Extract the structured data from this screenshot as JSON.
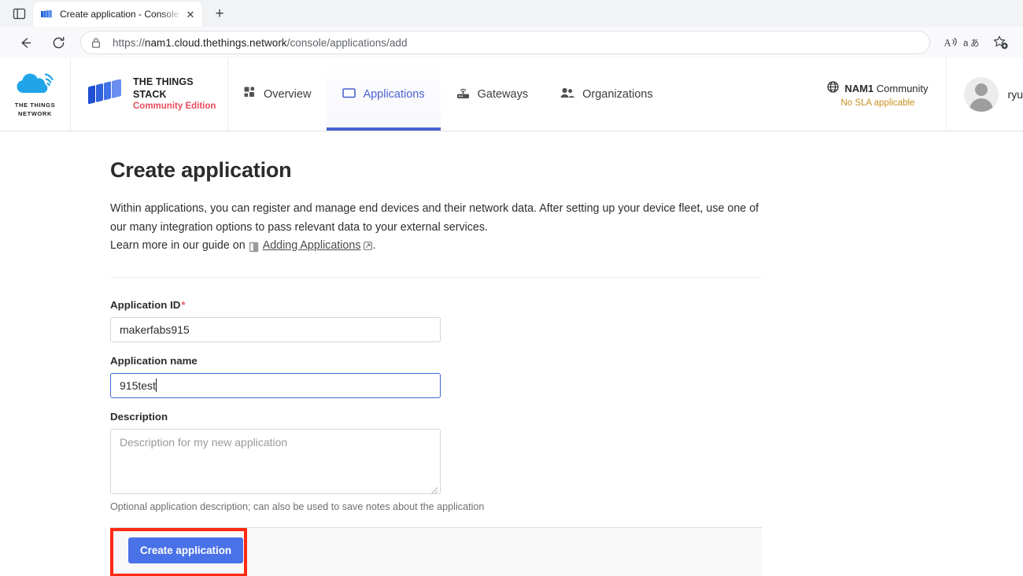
{
  "browser": {
    "tab": {
      "title": "Create application - Console - Th",
      "favicon_name": "ttn-stack-favicon",
      "close_label": "✕"
    },
    "new_tab_label": "+",
    "tab_tools_icon": "tab-list-icon",
    "nav": {
      "back_icon": "back-arrow-icon",
      "reload_icon": "reload-icon"
    },
    "omnibox": {
      "lock_icon": "lock-icon",
      "url_scheme": "https://",
      "url_host": "nam1.cloud.thethings.network",
      "url_path": "/console/applications/add",
      "read_aloud_icon": "read-aloud-icon",
      "translate_icon": "translate-icon",
      "favorite_icon": "add-favorite-star-icon"
    }
  },
  "app_header": {
    "logo": {
      "name": "the-things-network-logo",
      "line1": "THE THINGS",
      "line2": "NETWORK"
    },
    "brand": {
      "icon_name": "things-stack-blocks-icon",
      "line1": "THE THINGS STACK",
      "line2": "Community Edition",
      "accent_color": "#ea4b5a"
    },
    "nav_tabs": [
      {
        "label": "Overview",
        "icon": "grid-overview-icon",
        "active": false
      },
      {
        "label": "Applications",
        "icon": "application-square-icon",
        "active": true
      },
      {
        "label": "Gateways",
        "icon": "gateway-router-icon",
        "active": false
      },
      {
        "label": "Organizations",
        "icon": "organizations-people-icon",
        "active": false
      }
    ],
    "cluster": {
      "globe_icon": "globe-icon",
      "name": "NAM1",
      "type": "Community",
      "sla": "No SLA applicable",
      "sla_color": "#c8901f"
    },
    "user": {
      "avatar_name": "user-avatar-placeholder",
      "username": "ryu"
    },
    "active_tab_color": "#4b61d1"
  },
  "page": {
    "title": "Create application",
    "intro_paragraph": "Within applications, you can register and manage end devices and their network data. After setting up your device fleet, use one of our many integration options to pass relevant data to your external services.",
    "guide_prefix": "Learn more in our guide on",
    "guide_link": "Adding Applications",
    "guide_suffix": ".",
    "guide_doc_icon": "document-book-icon",
    "guide_external_icon": "external-link-icon"
  },
  "form": {
    "application_id": {
      "label": "Application ID",
      "required_mark": "*",
      "value": "makerfabs915",
      "placeholder": ""
    },
    "application_name": {
      "label": "Application name",
      "value": "915test",
      "placeholder": "",
      "focused": true
    },
    "description": {
      "label": "Description",
      "value": "",
      "placeholder": "Description for my new application",
      "help": "Optional application description; can also be used to save notes about the application"
    },
    "submit": {
      "label": "Create application",
      "color": "#4a72e8",
      "highlight_color": "#ff2a14"
    }
  }
}
